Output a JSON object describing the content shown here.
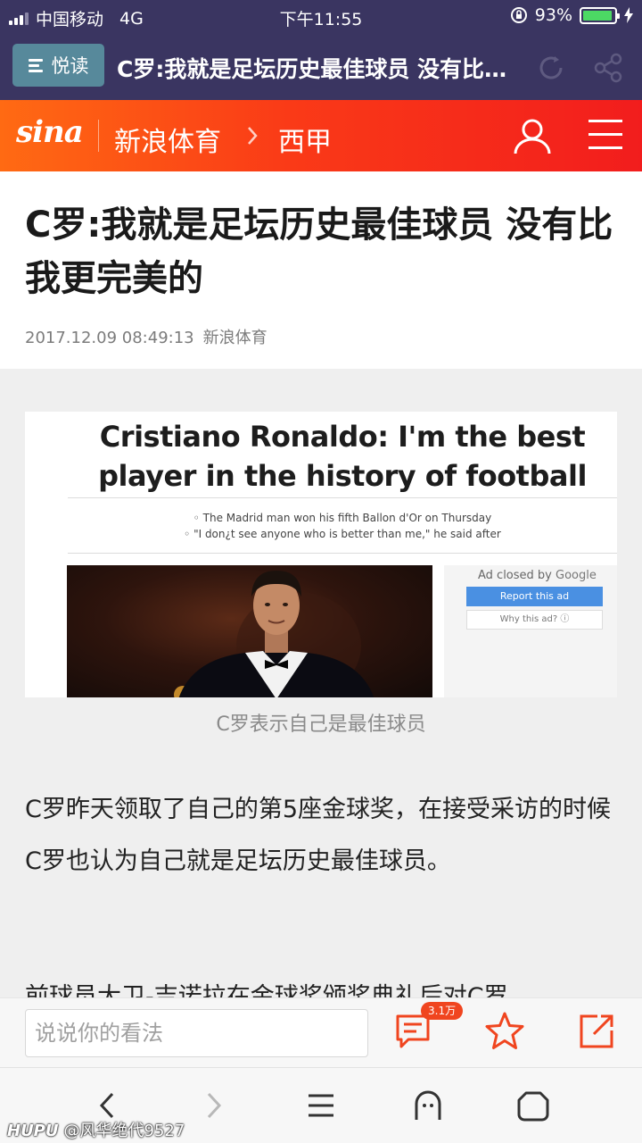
{
  "status_bar": {
    "carrier": "中国移动",
    "network": "4G",
    "time": "下午11:55",
    "battery_percent": "93%",
    "battery_level": 0.93,
    "battery_color": "#4cd964"
  },
  "reader_bar": {
    "reader_label": "悦读",
    "title": "C罗:我就是足坛历史最佳球员 没有比我更完美的",
    "icons": [
      "refresh-icon",
      "share-icon"
    ]
  },
  "site_header": {
    "logo": "sina",
    "channel": "新浪体育",
    "section": "西甲",
    "icons": [
      "user-icon",
      "menu-icon"
    ],
    "brand_color": "#fa3a17"
  },
  "article": {
    "title": "C罗:我就是足坛历史最佳球员 没有比我更完美的",
    "date": "2017.12.09 08:49:13",
    "source": "新浪体育",
    "figure": {
      "headline": "Cristiano Ronaldo: I'm the best player in the history of football",
      "bullet_1": "◦ The Madrid man won his fifth Ballon d'Or on Thursday",
      "bullet_2": "◦ \"I don¿t see anyone who is better than me,\" he said after",
      "ad_closed_prefix": "Ad closed by",
      "ad_closed_brand": "Google",
      "report_label": "Report this ad",
      "why_label": "Why this ad? ⓘ"
    },
    "caption": "C罗表示自己是最佳球员",
    "paragraph_1": "C罗昨天领取了自己的第5座金球奖，在接受采访的时候C罗也认为自己就是足坛历史最佳球员。",
    "paragraph_2": "前球员大卫-吉诺拉在金球奖颁奖典礼后对C罗"
  },
  "comment_bar": {
    "placeholder": "说说你的看法",
    "comment_count": "3.1万",
    "icons": [
      "comment-icon",
      "star-icon",
      "share-out-icon"
    ],
    "accent_color": "#f0451f"
  },
  "browser_nav": {
    "icons": [
      "back-icon",
      "forward-icon",
      "menu-icon",
      "ghost-icon",
      "home-icon"
    ]
  },
  "watermark": {
    "brand": "HUPU",
    "user": "@风华绝代9527"
  }
}
